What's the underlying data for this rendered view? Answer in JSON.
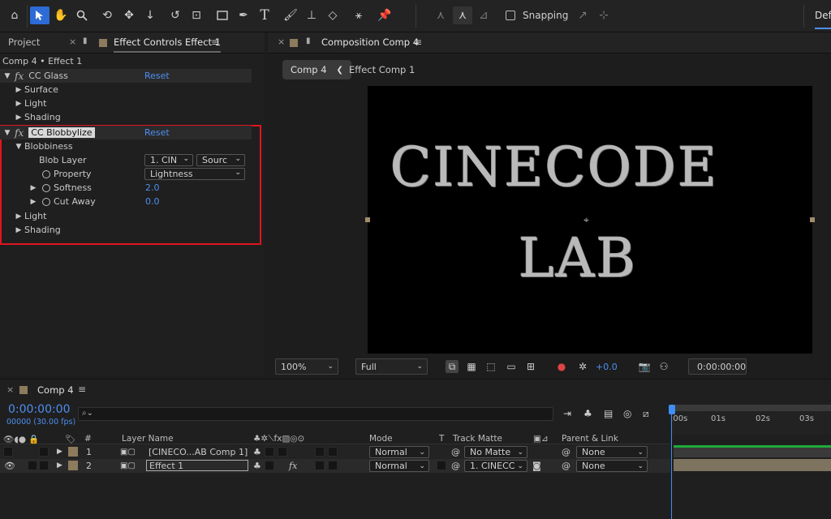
{
  "toolbar": {
    "snapping_label": "Snapping",
    "workspace_label": "Defa"
  },
  "effect_controls": {
    "tab_project": "Project",
    "tab_effect_controls": "Effect Controls Effect 1",
    "breadcrumb": "Comp 4 • Effect 1",
    "cc_glass": {
      "name": "CC Glass",
      "reset": "Reset",
      "items": [
        "Surface",
        "Light",
        "Shading"
      ]
    },
    "cc_blobbylize": {
      "name": "CC Blobbylize",
      "reset": "Reset",
      "blobbiness_label": "Blobbiness",
      "blob_layer_label": "Blob Layer",
      "blob_layer_value": "1. CIN",
      "blob_layer_source": "Sourc",
      "property_label": "Property",
      "property_value": "Lightness",
      "softness_label": "Softness",
      "softness_value": "2.0",
      "cut_away_label": "Cut Away",
      "cut_away_value": "0.0",
      "light_label": "Light",
      "shading_label": "Shading"
    }
  },
  "composition": {
    "tab_label": "Composition Comp 4",
    "crumb_active": "Comp 4",
    "crumb_next": "Effect Comp 1",
    "viewer_text_line1": "CINECODE",
    "viewer_text_line2": "LAB",
    "zoom": "100%",
    "resolution": "Full",
    "exposure": "+0.0",
    "timecode": "0:00:00:00"
  },
  "timeline": {
    "tab_label": "Comp 4",
    "current_time": "0:00:00:00",
    "frames": "00000 (30.00 fps)",
    "search_placeholder": "",
    "columns": {
      "hash": "#",
      "layer_name": "Layer Name",
      "mode": "Mode",
      "t": "T",
      "track_matte": "Track Matte",
      "parent_link": "Parent & Link"
    },
    "ticks": [
      ":00s",
      "01s",
      "02s",
      "03s"
    ],
    "layers": [
      {
        "num": "1",
        "name": "[CINECO...AB Comp 1]",
        "mode": "Normal",
        "matte": "No Matte",
        "parent": "None"
      },
      {
        "num": "2",
        "name": "Effect 1",
        "mode": "Normal",
        "matte": "1. CINECC",
        "parent": "None"
      }
    ]
  }
}
